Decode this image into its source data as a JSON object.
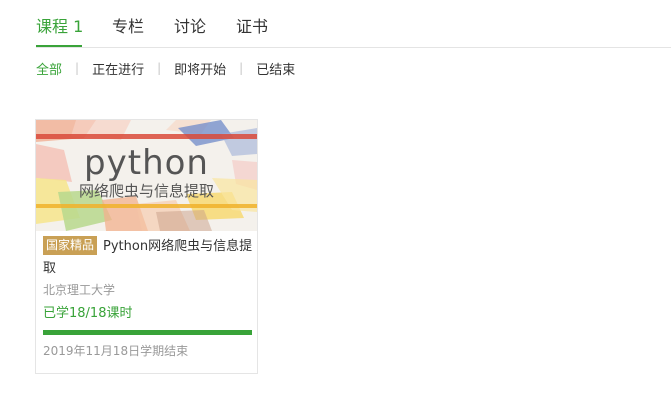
{
  "tabs": [
    {
      "label": "课程 1",
      "active": true
    },
    {
      "label": "专栏",
      "active": false
    },
    {
      "label": "讨论",
      "active": false
    },
    {
      "label": "证书",
      "active": false
    }
  ],
  "filters": [
    {
      "label": "全部",
      "active": true
    },
    {
      "label": "正在进行",
      "active": false
    },
    {
      "label": "即将开始",
      "active": false
    },
    {
      "label": "已结束",
      "active": false
    }
  ],
  "filter_separator": "|",
  "course": {
    "cover_title": "python",
    "cover_subtitle": "网络爬虫与信息提取",
    "badge": "国家精品",
    "title": "Python网络爬虫与信息提取",
    "school": "北京理工大学",
    "progress_label": "已学18/18课时",
    "progress_fraction": 1.0,
    "end_date": "2019年11月18日学期结束"
  },
  "colors": {
    "accent": "#39a339",
    "badge": "#c9a055",
    "muted_text": "#999999"
  }
}
